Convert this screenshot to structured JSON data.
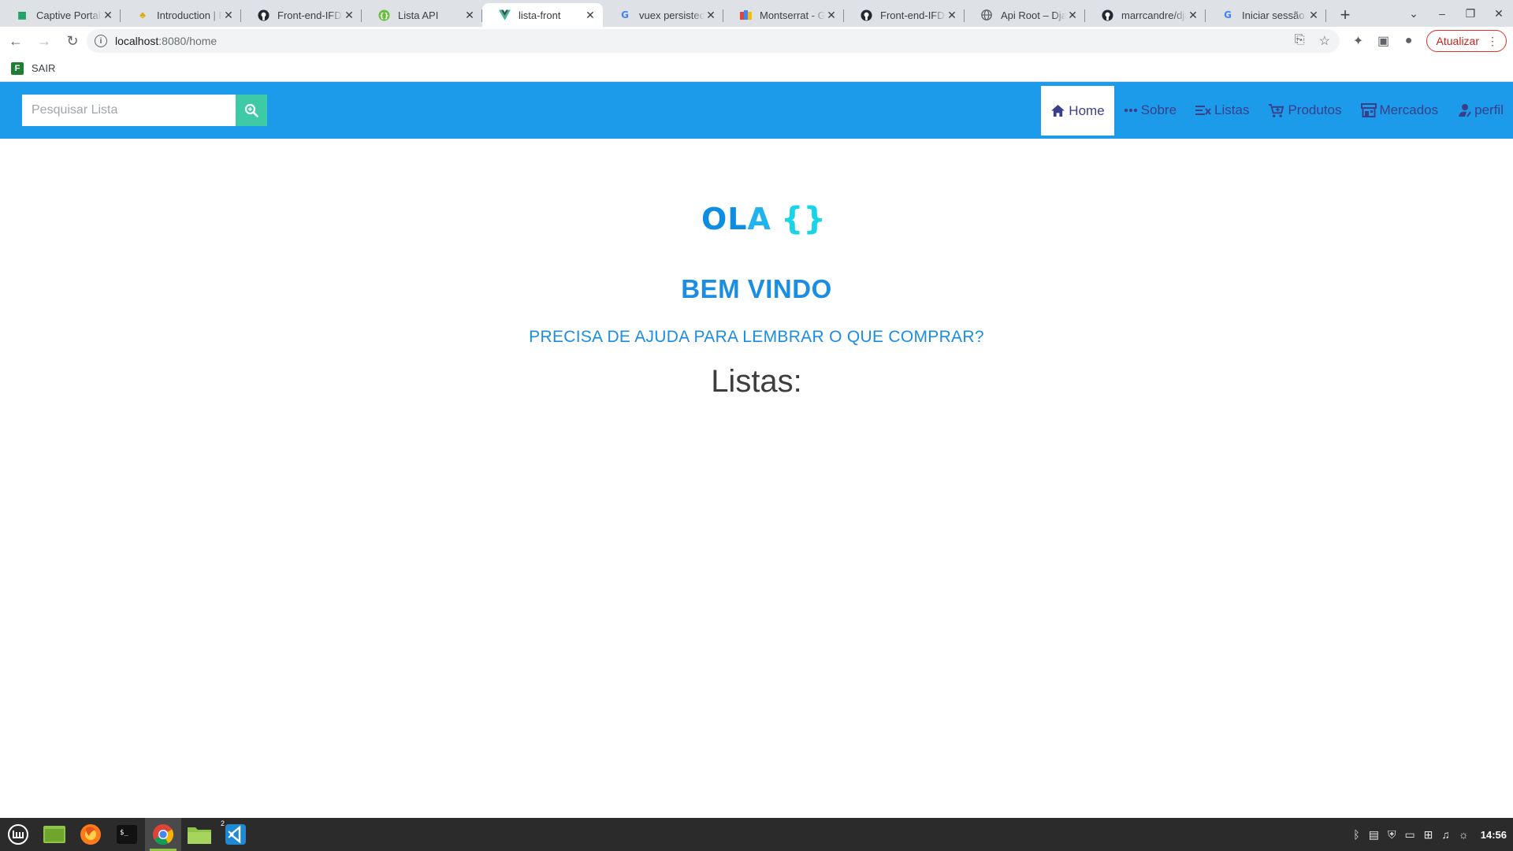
{
  "browser": {
    "tabs": [
      {
        "title": "Captive Portal",
        "icon": "grid-favicon",
        "active": false
      },
      {
        "title": "Introduction | F",
        "icon": "pineapple-favicon",
        "active": false
      },
      {
        "title": "Front-end-IFDC",
        "icon": "github-favicon",
        "active": false
      },
      {
        "title": "Lista API",
        "icon": "api-favicon",
        "active": false
      },
      {
        "title": "lista-front",
        "icon": "vue-favicon",
        "active": true
      },
      {
        "title": "vuex persisted",
        "icon": "google-favicon",
        "active": false
      },
      {
        "title": "Montserrat - Go",
        "icon": "fonts-favicon",
        "active": false
      },
      {
        "title": "Front-end-IFDC",
        "icon": "github-favicon",
        "active": false
      },
      {
        "title": "Api Root – Djan",
        "icon": "globe-favicon",
        "active": false
      },
      {
        "title": "marrcandre/dja",
        "icon": "github-favicon",
        "active": false
      },
      {
        "title": "Iniciar sessão –",
        "icon": "google-favicon",
        "active": false
      }
    ],
    "url_host": "localhost",
    "url_path": ":8080/home",
    "update_button": "Atualizar",
    "bookmark": "SAIR"
  },
  "navbar": {
    "search_placeholder": "Pesquisar Lista",
    "links": [
      {
        "label": "Home",
        "icon": "home-icon",
        "active": true
      },
      {
        "label": "Sobre",
        "icon": "dots-icon",
        "active": false
      },
      {
        "label": "Listas",
        "icon": "list-icon",
        "active": false
      },
      {
        "label": "Produtos",
        "icon": "cart-icon",
        "active": false
      },
      {
        "label": "Mercados",
        "icon": "store-icon",
        "active": false
      },
      {
        "label": "perfil",
        "icon": "user-icon",
        "active": false
      }
    ]
  },
  "hero": {
    "logo_text_1": "OL",
    "logo_text_2": "A",
    "logo_brace": "{}",
    "welcome": "BEM VINDO",
    "subtitle": "PRECISA DE AJUDA PARA LEMBRAR O QUE COMPRAR?",
    "lists_title": "Listas:"
  },
  "system": {
    "clock": "14:56",
    "vscode_badge": "2"
  },
  "colors": {
    "navbar": "#1b9bea",
    "search_button": "#3ec9a7",
    "accent_text": "#1b8de3",
    "nav_text": "#3b3f8a"
  }
}
